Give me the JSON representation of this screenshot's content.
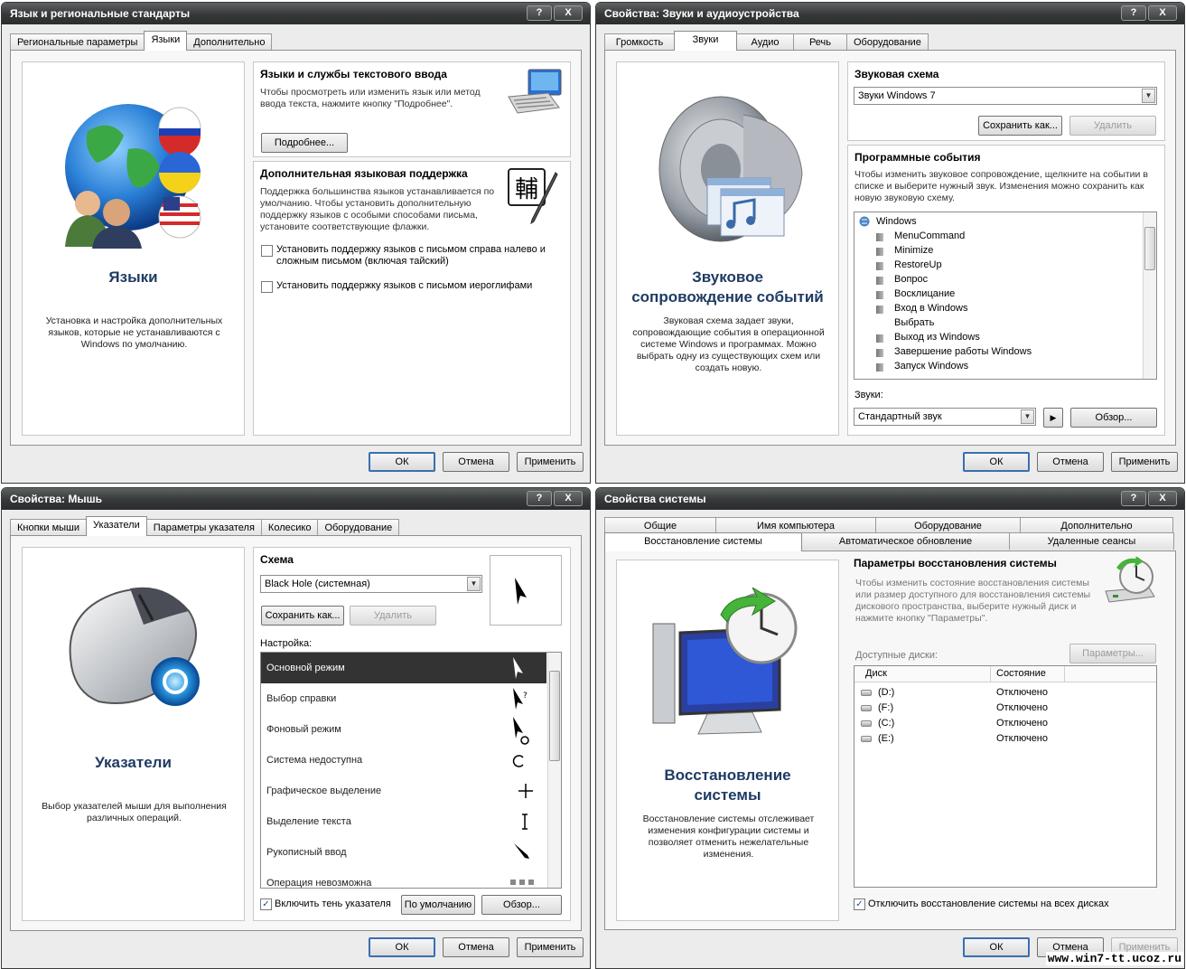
{
  "w1": {
    "title": "Язык и региональные стандарты",
    "tabs": [
      "Региональные параметры",
      "Языки",
      "Дополнительно"
    ],
    "left_title": "Языки",
    "left_desc": "Установка и настройка дополнительных языков, которые не устанавливаются с Windows по умолчанию.",
    "s1_title": "Языки и службы текстового ввода",
    "s1_text": "Чтобы просмотреть или изменить язык или метод ввода текста, нажмите кнопку \"Подробнее\".",
    "s1_btn": "Подробнее...",
    "s2_title": "Дополнительная языковая поддержка",
    "s2_text": "Поддержка большинства языков устанавливается по умолчанию. Чтобы установить дополнительную поддержку языков с особыми способами письма, установите соответствующие флажки.",
    "chk1": "Установить поддержку языков с письмом справа налево и сложным письмом (включая тайский)",
    "chk2": "Установить поддержку языков с письмом иероглифами",
    "glyph": "輔",
    "ok": "ОК",
    "cancel": "Отмена",
    "apply": "Применить"
  },
  "w2": {
    "title": "Свойства: Звуки и аудиоустройства",
    "tabs": [
      "Громкость",
      "Звуки",
      "Аудио",
      "Речь",
      "Оборудование"
    ],
    "left_title1": "Звуковое",
    "left_title2": "сопровождение событий",
    "left_desc": "Звуковая схема задает звуки, сопровождающие события в операционной системе Windows и программах. Можно выбрать одну из существующих схем или создать новую.",
    "scheme_label": "Звуковая схема",
    "scheme_value": "Звуки Windows 7",
    "save_btn": "Сохранить как...",
    "delete_btn": "Удалить",
    "events_title": "Программные события",
    "events_text": "Чтобы изменить звуковое сопровождение, щелкните на событии в списке и выберите нужный звук. Изменения можно сохранить как новую звуковую схему.",
    "events": [
      "Windows",
      "MenuCommand",
      "Minimize",
      "RestoreUp",
      "Вопрос",
      "Восклицание",
      "Вход в Windows",
      "Выбрать",
      "Выход из Windows",
      "Завершение работы Windows",
      "Запуск Windows"
    ],
    "sounds_label": "Звуки:",
    "sound_value": "Стандартный звук",
    "browse_btn": "Обзор...",
    "ok": "ОК",
    "cancel": "Отмена",
    "apply": "Применить"
  },
  "w3": {
    "title": "Свойства: Мышь",
    "tabs": [
      "Кнопки мыши",
      "Указатели",
      "Параметры указателя",
      "Колесико",
      "Оборудование"
    ],
    "left_title": "Указатели",
    "left_desc": "Выбор указателей мыши для выполнения различных операций.",
    "scheme_label": "Схема",
    "scheme_value": "Black Hole (системная)",
    "save_btn": "Сохранить как...",
    "delete_btn": "Удалить",
    "custom_label": "Настройка:",
    "cursors": [
      "Основной режим",
      "Выбор справки",
      "Фоновый режим",
      "Система недоступна",
      "Графическое выделение",
      "Выделение текста",
      "Рукописный ввод",
      "Операция невозможна"
    ],
    "shadow": "Включить тень указателя",
    "default_btn": "По умолчанию",
    "browse_btn": "Обзор...",
    "ok": "ОК",
    "cancel": "Отмена",
    "apply": "Применить"
  },
  "w4": {
    "title": "Свойства системы",
    "tabs_row1": [
      "Общие",
      "Имя компьютера",
      "Оборудование",
      "Дополнительно"
    ],
    "tabs_row2": [
      "Восстановление системы",
      "Автоматическое обновление",
      "Удаленные сеансы"
    ],
    "left_title1": "Восстановление",
    "left_title2": "системы",
    "left_desc": "Восстановление системы отслеживает изменения конфигурации системы и позволяет отменить нежелательные изменения.",
    "params_title": "Параметры восстановления системы",
    "params_text": "Чтобы изменить состояние восстановления системы или размер доступного для восстановления системы дискового пространства, выберите нужный диск и нажмите кнопку \"Параметры\".",
    "params_btn": "Параметры...",
    "disks_label": "Доступные диски:",
    "col_disk": "Диск",
    "col_state": "Состояние",
    "disks": [
      {
        "name": "(D:)",
        "state": "Отключено"
      },
      {
        "name": "(F:)",
        "state": "Отключено"
      },
      {
        "name": "(C:)",
        "state": "Отключено"
      },
      {
        "name": "(E:)",
        "state": "Отключено"
      }
    ],
    "disable_all": "Отключить восстановление системы на всех дисках",
    "ok": "ОК",
    "cancel": "Отмена",
    "apply": "Применить"
  },
  "tb_help": "?",
  "tb_close": "X",
  "watermark": "www.win7-tt.ucoz.ru"
}
